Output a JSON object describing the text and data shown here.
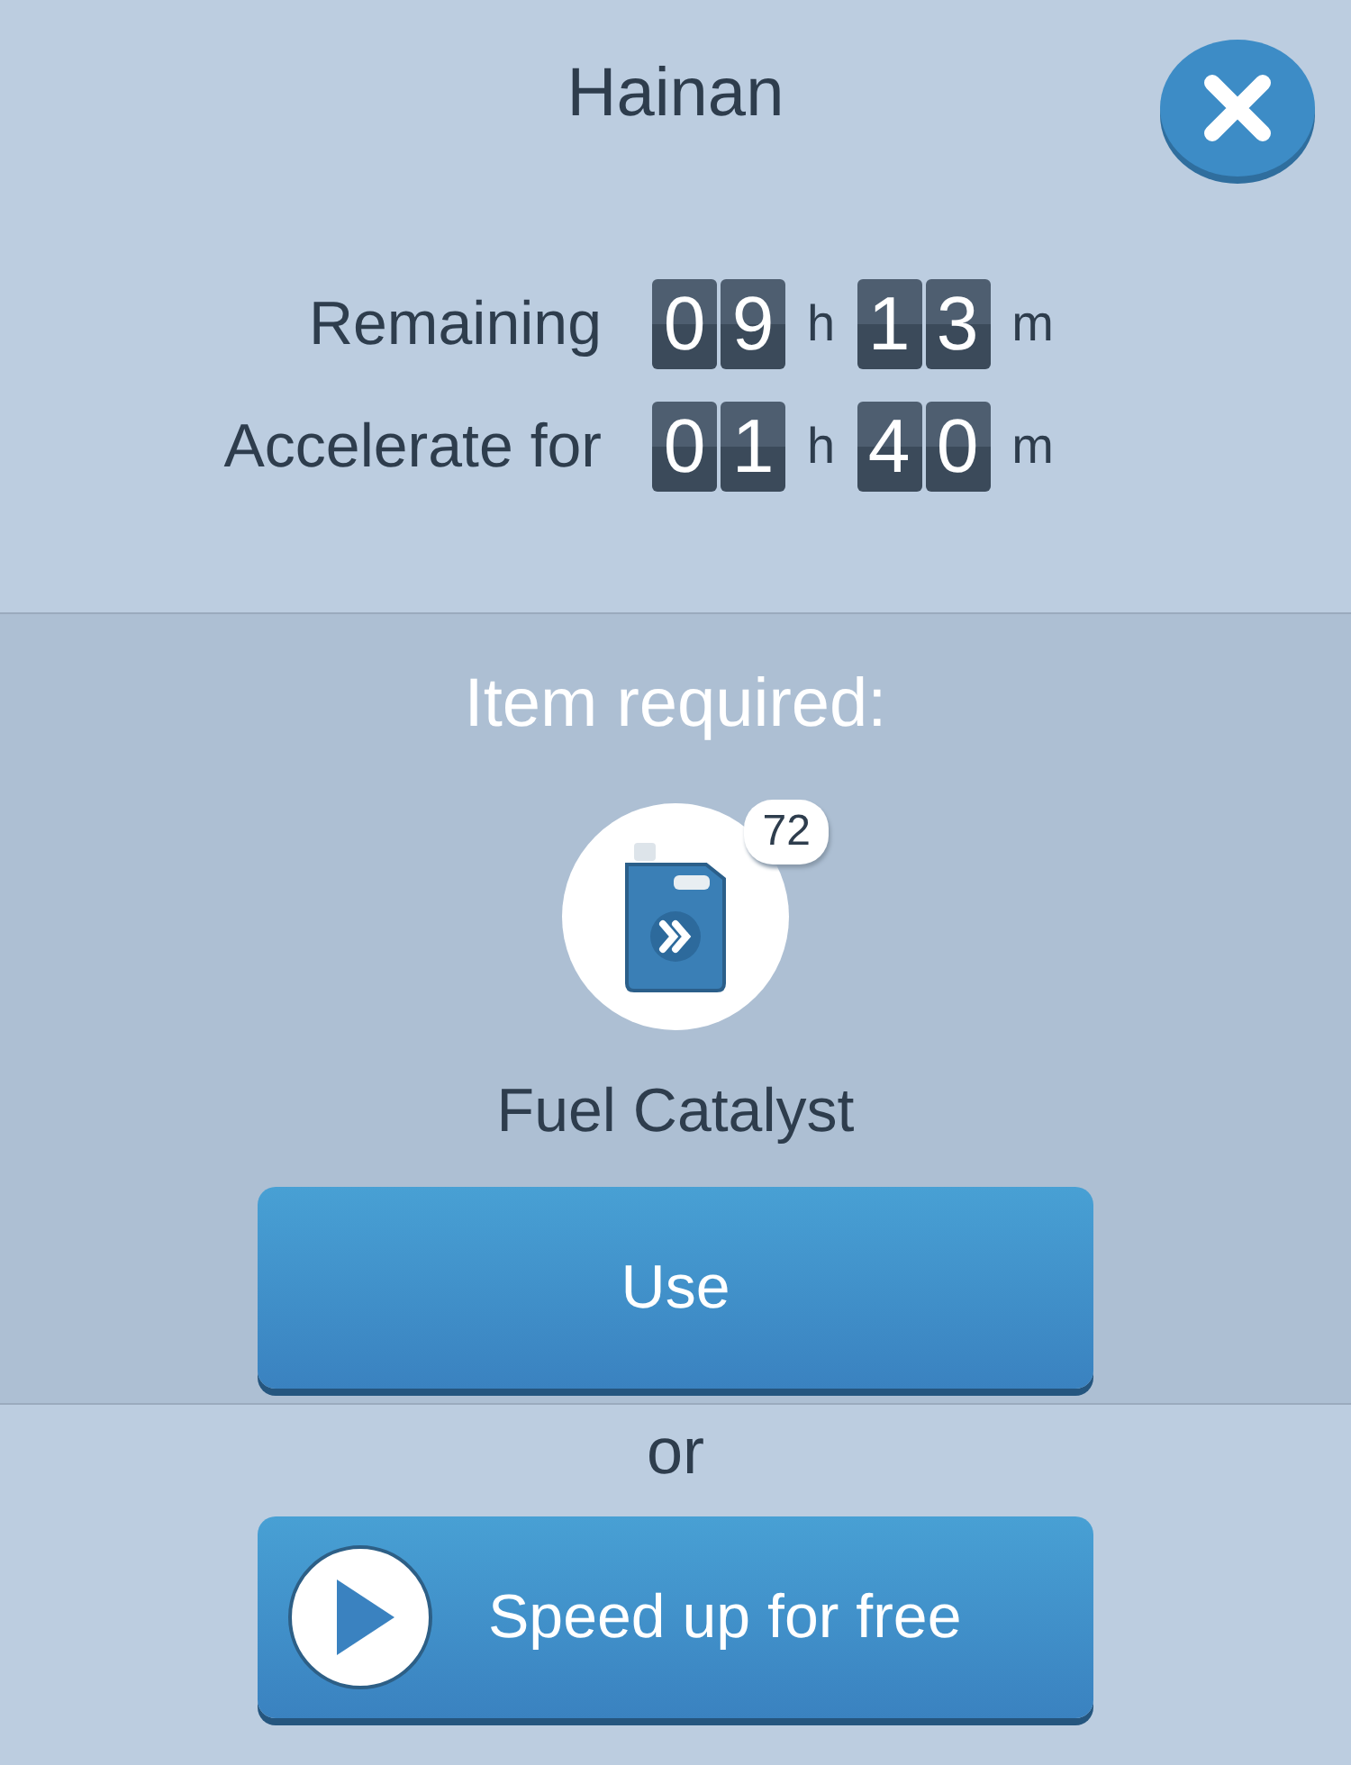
{
  "title": "Hainan",
  "timers": [
    {
      "label": "Remaining",
      "hours": [
        "0",
        "9"
      ],
      "hour_unit": "h",
      "minutes": [
        "1",
        "3"
      ],
      "minute_unit": "m"
    },
    {
      "label": "Accelerate for",
      "hours": [
        "0",
        "1"
      ],
      "hour_unit": "h",
      "minutes": [
        "4",
        "0"
      ],
      "minute_unit": "m"
    }
  ],
  "item_heading": "Item required:",
  "item": {
    "count": "72",
    "name": "Fuel Catalyst"
  },
  "use_button": "Use",
  "separator": "or",
  "free_button": "Speed up for free"
}
